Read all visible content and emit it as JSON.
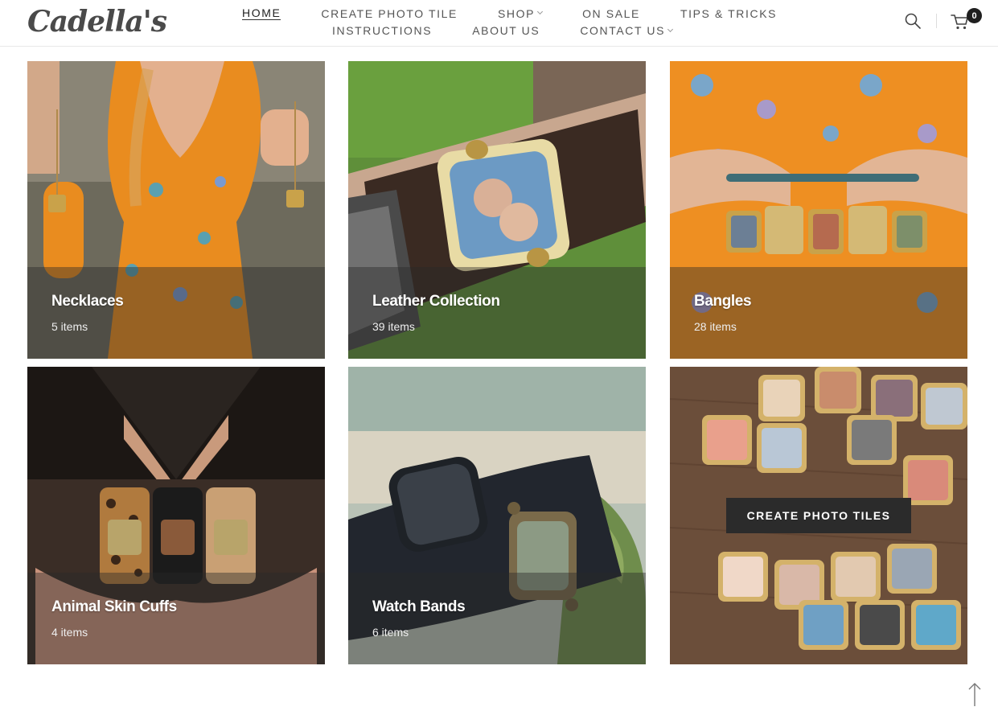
{
  "brand": {
    "logo_text": "Cadella's"
  },
  "nav": {
    "row1": [
      {
        "label": "HOME",
        "active": true,
        "dropdown": false
      },
      {
        "label": "CREATE PHOTO TILE",
        "active": false,
        "dropdown": false
      },
      {
        "label": "SHOP",
        "active": false,
        "dropdown": true
      },
      {
        "label": "ON SALE",
        "active": false,
        "dropdown": false
      },
      {
        "label": "TIPS & TRICKS",
        "active": false,
        "dropdown": false
      }
    ],
    "row2": [
      {
        "label": "INSTRUCTIONS",
        "active": false,
        "dropdown": false
      },
      {
        "label": "ABOUT US",
        "active": false,
        "dropdown": false
      },
      {
        "label": "CONTACT US",
        "active": false,
        "dropdown": true
      }
    ]
  },
  "header_icons": {
    "search": "search-icon",
    "cart": "cart-icon",
    "cart_count": "0"
  },
  "categories": [
    {
      "title": "Necklaces",
      "count": "5 items"
    },
    {
      "title": "Leather Collection",
      "count": "39 items"
    },
    {
      "title": "Bangles",
      "count": "28 items"
    },
    {
      "title": "Animal Skin Cuffs",
      "count": "4 items"
    },
    {
      "title": "Watch Bands",
      "count": "6 items"
    }
  ],
  "promo": {
    "button_label": "CREATE PHOTO TILES"
  },
  "colors": {
    "accent_dark": "#2b2b2b",
    "nav_text": "#555555",
    "overlay": "rgba(40,40,40,0.42)"
  }
}
